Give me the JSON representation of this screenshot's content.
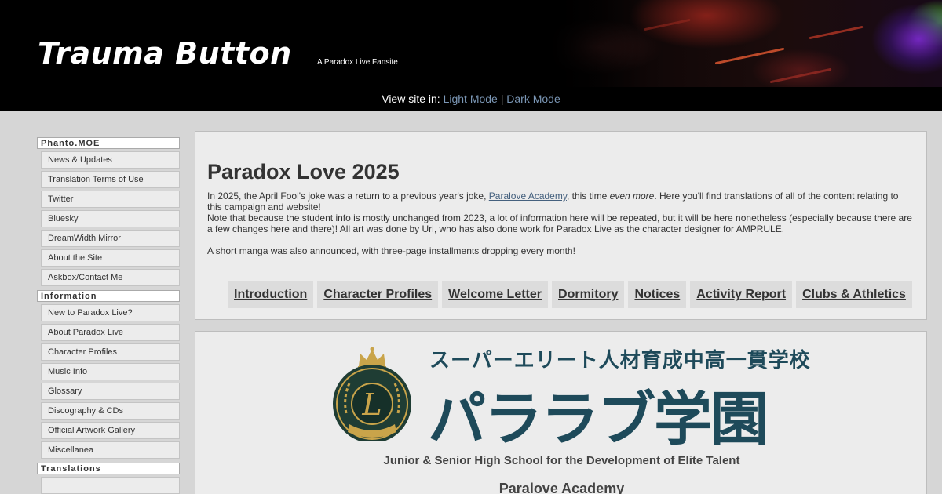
{
  "header": {
    "title": "Trauma Button",
    "subtitle": "A Paradox Live Fansite"
  },
  "modebar": {
    "prefix": "View site in:",
    "light": "Light Mode",
    "separator": "|",
    "dark": "Dark Mode"
  },
  "sidebar": {
    "sections": [
      {
        "heading": "Phanto.MOE",
        "items": [
          "News & Updates",
          "Translation Terms of Use",
          "Twitter",
          "Bluesky",
          "DreamWidth Mirror",
          "About the Site",
          "Askbox/Contact Me"
        ]
      },
      {
        "heading": "Information",
        "items": [
          "New to Paradox Live?",
          "About Paradox Live",
          "Character Profiles",
          "Music Info",
          "Glossary",
          "Discography & CDs",
          "Official Artwork Gallery",
          "Miscellanea"
        ]
      },
      {
        "heading": "Translations",
        "items": []
      }
    ]
  },
  "main": {
    "title": "Paradox Love 2025",
    "para1_a": "In 2025, the April Fool's joke was a return to a previous year's joke, ",
    "para1_link": "Paralove Academy",
    "para1_b": ", this time ",
    "para1_em": "even more",
    "para1_c": ". Here you'll find translations of all of the content relating to this campaign and website!",
    "para2": "Note that because the student info is mostly unchanged from 2023, a lot of information here will be repeated, but it will be here nonetheless (especially because there are a few changes here and there)! All art was done by Uri, who has also done work for Paradox Live as the character designer for AMPRULE.",
    "para3": "A short manga was also announced, with three-page installments dropping every month!",
    "nav": [
      "Introduction",
      "Character Profiles",
      "Welcome Letter",
      "Dormitory",
      "Notices",
      "Activity Report",
      "Clubs & Athletics"
    ]
  },
  "academy": {
    "jp_top": "スーパーエリート人材育成中高一貫学校",
    "jp_main": "パララブ学園",
    "en_sub": "Junior & Senior High School for the Development of Elite Talent",
    "en_name": "Paralove Academy"
  },
  "colors": {
    "link": "#44607e",
    "crest_green": "#1f3d34",
    "crest_gold": "#c9a44a",
    "logo_text": "#1e4a5a"
  }
}
